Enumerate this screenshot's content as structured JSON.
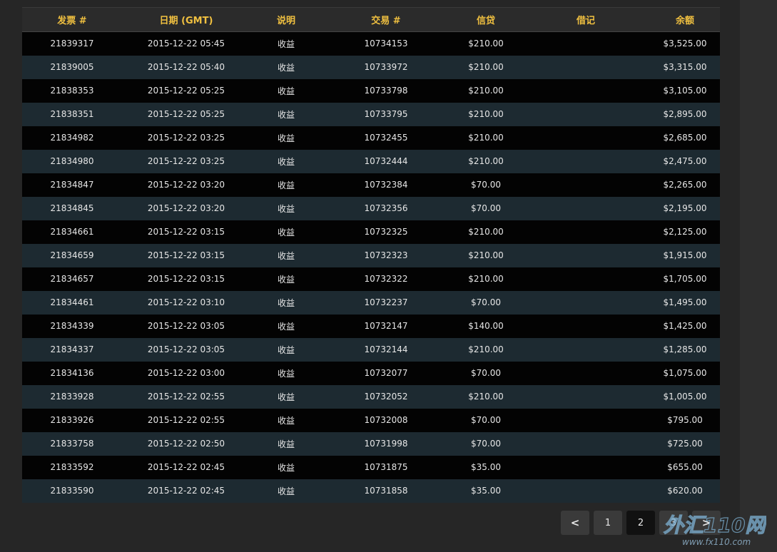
{
  "table": {
    "headers": [
      "发票 #",
      "日期 (GMT)",
      "说明",
      "交易 #",
      "信贷",
      "借记",
      "余额"
    ],
    "rows": [
      [
        "21839317",
        "2015-12-22 05:45",
        "收益",
        "10734153",
        "$210.00",
        "",
        "$3,525.00"
      ],
      [
        "21839005",
        "2015-12-22 05:40",
        "收益",
        "10733972",
        "$210.00",
        "",
        "$3,315.00"
      ],
      [
        "21838353",
        "2015-12-22 05:25",
        "收益",
        "10733798",
        "$210.00",
        "",
        "$3,105.00"
      ],
      [
        "21838351",
        "2015-12-22 05:25",
        "收益",
        "10733795",
        "$210.00",
        "",
        "$2,895.00"
      ],
      [
        "21834982",
        "2015-12-22 03:25",
        "收益",
        "10732455",
        "$210.00",
        "",
        "$2,685.00"
      ],
      [
        "21834980",
        "2015-12-22 03:25",
        "收益",
        "10732444",
        "$210.00",
        "",
        "$2,475.00"
      ],
      [
        "21834847",
        "2015-12-22 03:20",
        "收益",
        "10732384",
        "$70.00",
        "",
        "$2,265.00"
      ],
      [
        "21834845",
        "2015-12-22 03:20",
        "收益",
        "10732356",
        "$70.00",
        "",
        "$2,195.00"
      ],
      [
        "21834661",
        "2015-12-22 03:15",
        "收益",
        "10732325",
        "$210.00",
        "",
        "$2,125.00"
      ],
      [
        "21834659",
        "2015-12-22 03:15",
        "收益",
        "10732323",
        "$210.00",
        "",
        "$1,915.00"
      ],
      [
        "21834657",
        "2015-12-22 03:15",
        "收益",
        "10732322",
        "$210.00",
        "",
        "$1,705.00"
      ],
      [
        "21834461",
        "2015-12-22 03:10",
        "收益",
        "10732237",
        "$70.00",
        "",
        "$1,495.00"
      ],
      [
        "21834339",
        "2015-12-22 03:05",
        "收益",
        "10732147",
        "$140.00",
        "",
        "$1,425.00"
      ],
      [
        "21834337",
        "2015-12-22 03:05",
        "收益",
        "10732144",
        "$210.00",
        "",
        "$1,285.00"
      ],
      [
        "21834136",
        "2015-12-22 03:00",
        "收益",
        "10732077",
        "$70.00",
        "",
        "$1,075.00"
      ],
      [
        "21833928",
        "2015-12-22 02:55",
        "收益",
        "10732052",
        "$210.00",
        "",
        "$1,005.00"
      ],
      [
        "21833926",
        "2015-12-22 02:55",
        "收益",
        "10732008",
        "$70.00",
        "",
        "$795.00"
      ],
      [
        "21833758",
        "2015-12-22 02:50",
        "收益",
        "10731998",
        "$70.00",
        "",
        "$725.00"
      ],
      [
        "21833592",
        "2015-12-22 02:45",
        "收益",
        "10731875",
        "$35.00",
        "",
        "$655.00"
      ],
      [
        "21833590",
        "2015-12-22 02:45",
        "收益",
        "10731858",
        "$35.00",
        "",
        "$620.00"
      ]
    ]
  },
  "pagination": {
    "prev_label": "<",
    "pages": [
      "1",
      "2",
      "3"
    ],
    "current_page": "2",
    "next_label": ">"
  },
  "watermark": {
    "brand_text": "外汇110网",
    "url_text": "www.fx110.com"
  },
  "colors": {
    "header_text": "#f0c040",
    "row_dark": "#030303",
    "row_teal": "#1d2a31",
    "page_bg": "#262626"
  }
}
